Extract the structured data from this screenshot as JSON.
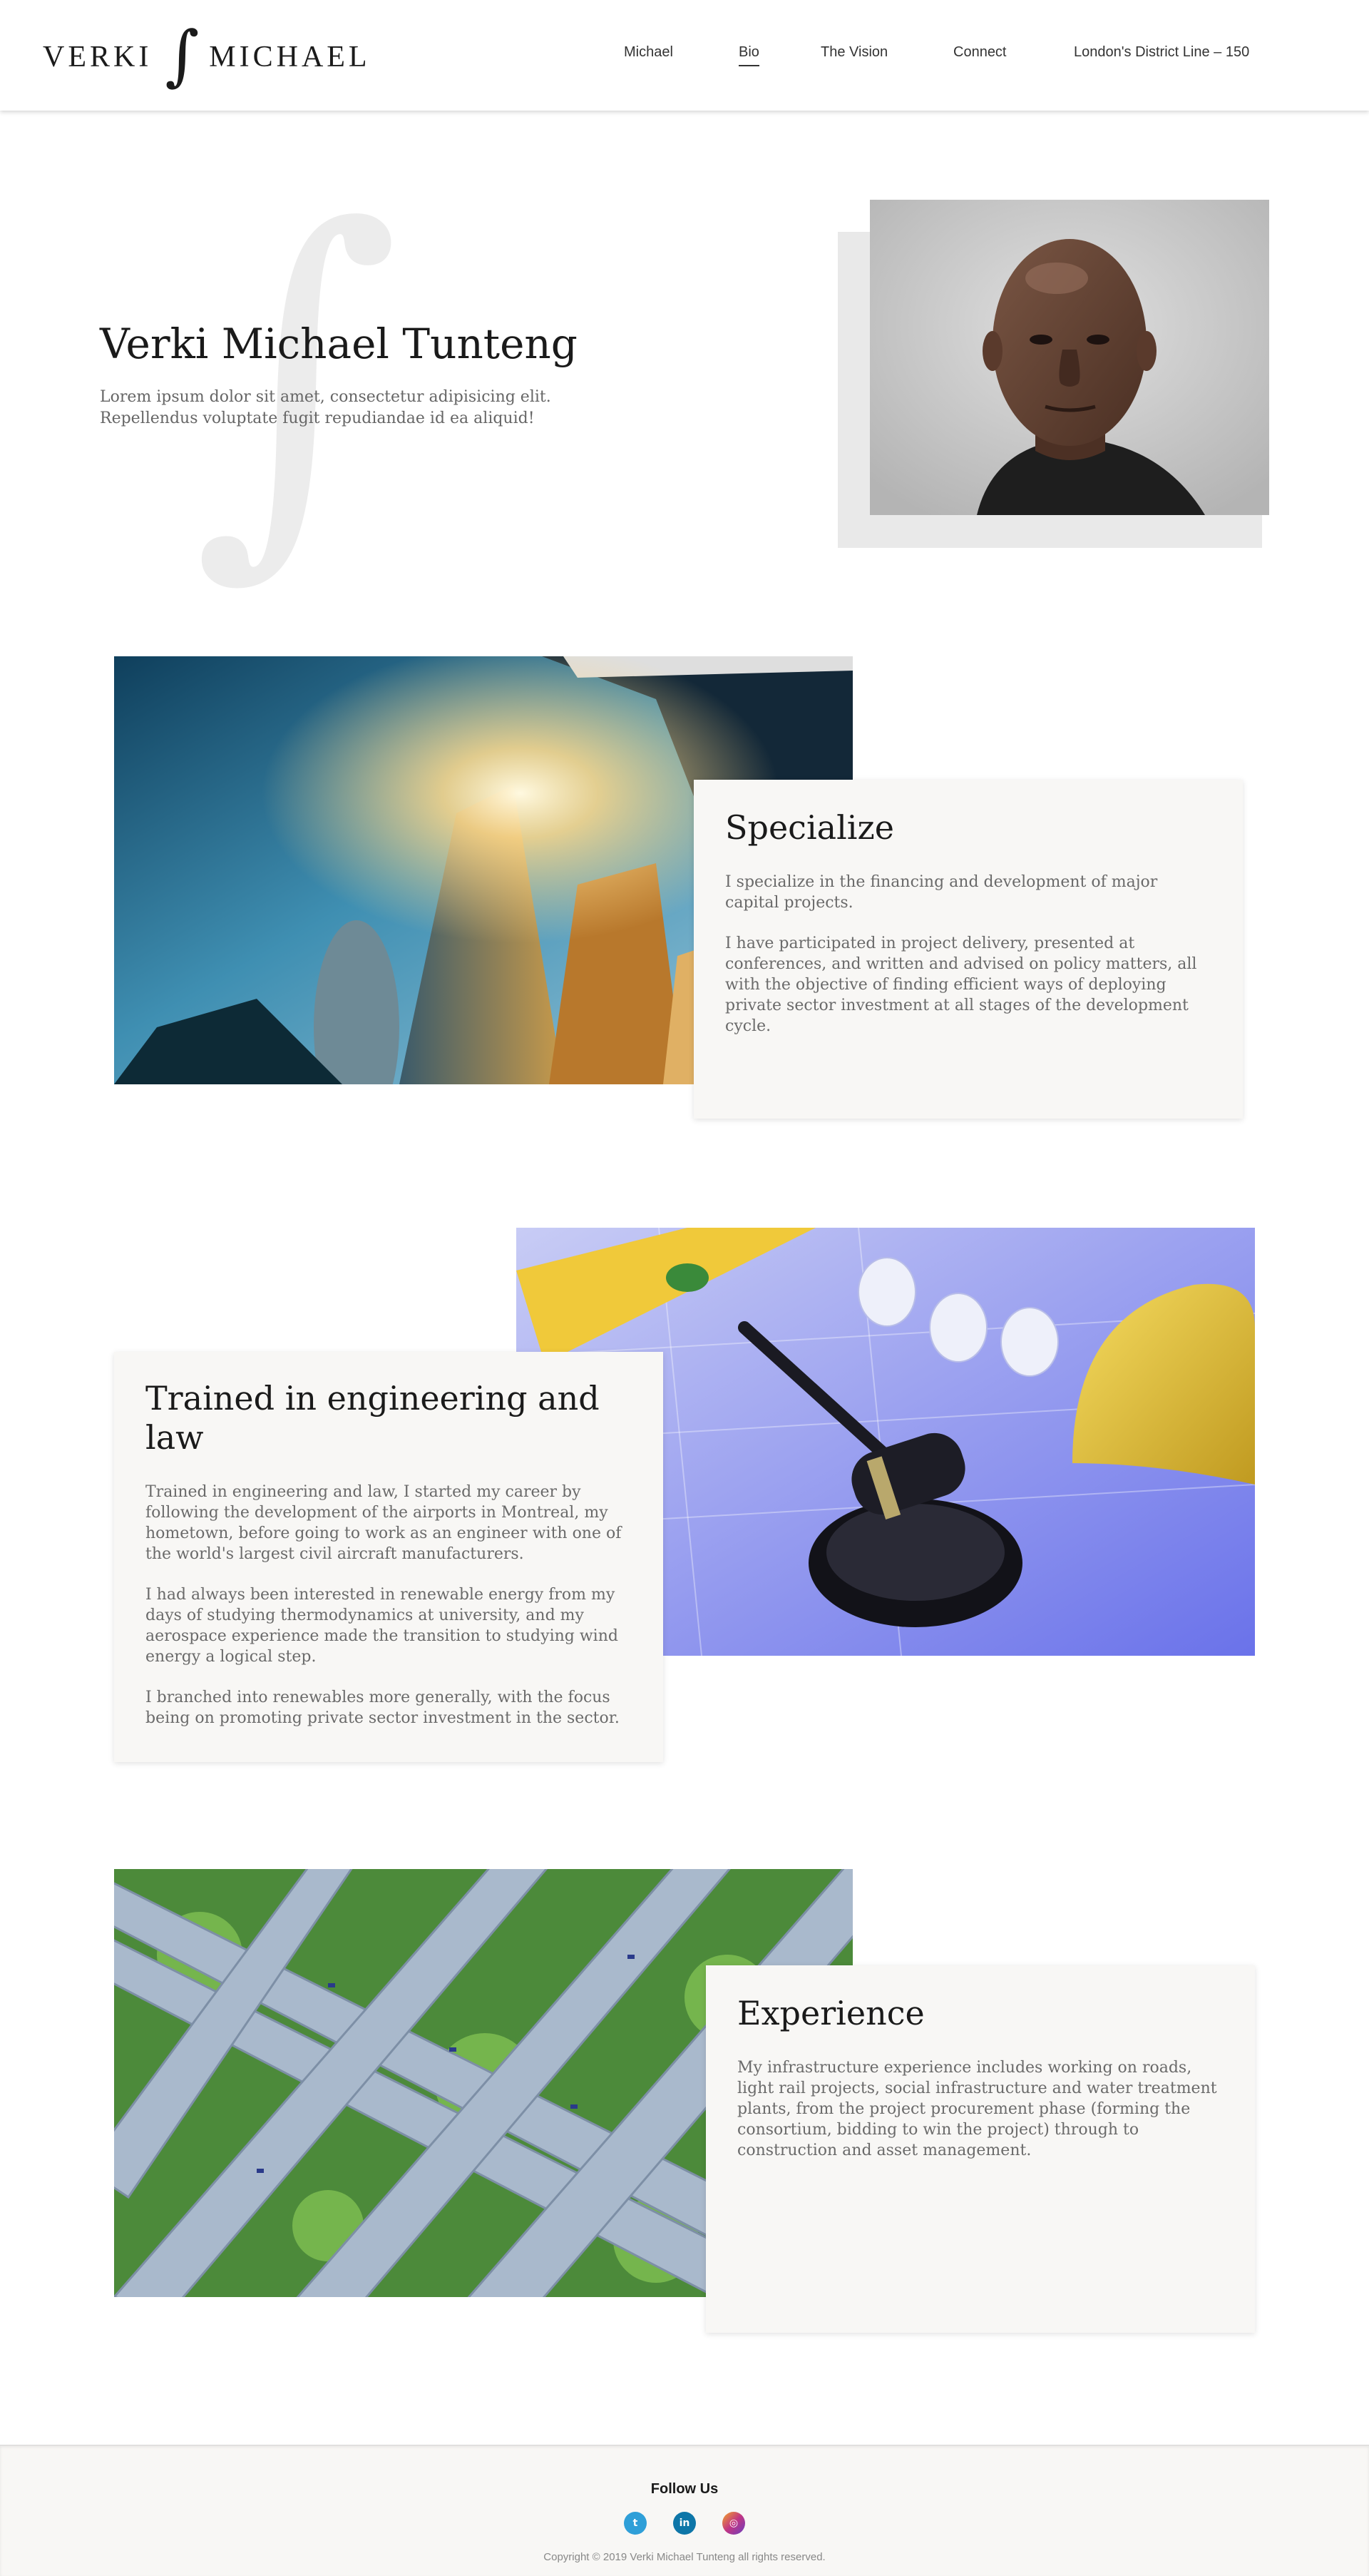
{
  "header": {
    "logo_left": "VERKI",
    "logo_mark": "∫",
    "logo_right": "MICHAEL",
    "nav": [
      {
        "label": "Michael",
        "active": false
      },
      {
        "label": "Bio",
        "active": true
      },
      {
        "label": "The Vision",
        "active": false
      },
      {
        "label": "Connect",
        "active": false
      },
      {
        "label": "London's District Line – 150",
        "active": false
      }
    ]
  },
  "hero": {
    "mark": "∫",
    "title": "Verki Michael Tunteng",
    "text": "Lorem ipsum dolor sit amet, consectetur adipisicing elit. Repellendus  voluptate fugit repudiandae id ea aliquid!"
  },
  "sections": {
    "specialize": {
      "title": "Specialize",
      "paragraphs": [
        "I specialize in the financing and development of major capital projects.",
        "I have participated in project delivery, presented at conferences, and written and advised on policy matters, all with the objective of finding efficient ways of deploying private sector investment at all stages of the development cycle."
      ]
    },
    "trained": {
      "title": "Trained in engineering and law",
      "paragraphs": [
        "Trained in engineering and law, I started my career by following the development of the airports in Montreal, my hometown, before going to work as an engineer with one of the world's largest civil aircraft manufacturers.",
        "I had always been interested in renewable energy from my days of studying thermodynamics at university, and my aerospace experience made the transition to studying wind energy a logical step.",
        "I branched into renewables more generally, with the focus being on promoting private sector investment in the sector."
      ]
    },
    "experience": {
      "title": "Experience",
      "paragraphs": [
        "My infrastructure experience includes working on roads, light rail projects, social infrastructure and water treatment plants, from the project procurement phase (forming the consortium, bidding to win the project) through to construction and asset management."
      ]
    }
  },
  "footer": {
    "follow": "Follow Us",
    "social": [
      {
        "icon": "twitter-icon",
        "glyph": "t",
        "color": "#2f9fd8"
      },
      {
        "icon": "linkedin-icon",
        "glyph": "in",
        "color": "#0e76a8"
      },
      {
        "icon": "instagram-icon",
        "glyph": "◎",
        "color": "#c13584"
      }
    ],
    "copyright": "Copyright © 2019 Verki Michael Tunteng all rights reserved."
  },
  "colors": {
    "card_bg": "#f8f7f5",
    "text_dark": "#1a1a1a",
    "text_muted": "#6a6a6a"
  }
}
